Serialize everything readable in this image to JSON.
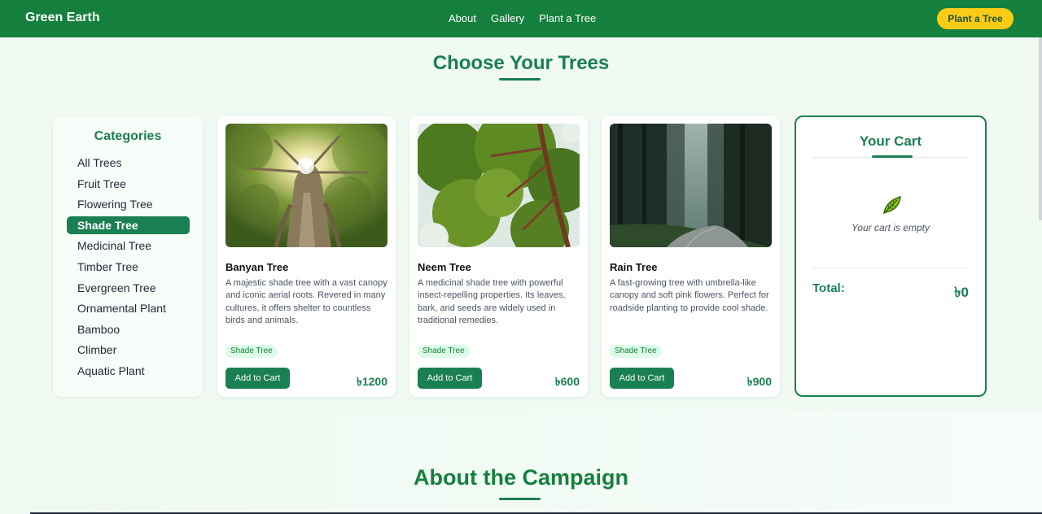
{
  "nav": {
    "brand": "Green Earth",
    "links": [
      "About",
      "Gallery",
      "Plant a Tree"
    ],
    "cta": "Plant a Tree"
  },
  "trees_section": {
    "title": "Choose Your Trees"
  },
  "categories": {
    "title": "Categories",
    "items": [
      "All Trees",
      "Fruit Tree",
      "Flowering Tree",
      "Shade Tree",
      "Medicinal Tree",
      "Timber Tree",
      "Evergreen Tree",
      "Ornamental Plant",
      "Bamboo",
      "Climber",
      "Aquatic Plant"
    ],
    "active": "Shade Tree"
  },
  "cards": [
    {
      "name": "Banyan Tree",
      "description": "A majestic shade tree with a vast canopy and iconic aerial roots. Revered in many cultures, it offers shelter to countless birds and animals.",
      "tag": "Shade Tree",
      "button": "Add to Cart",
      "price": "৳1200"
    },
    {
      "name": "Neem Tree",
      "description": "A medicinal shade tree with powerful insect-repelling properties. Its leaves, bark, and seeds are widely used in traditional remedies.",
      "tag": "Shade Tree",
      "button": "Add to Cart",
      "price": "৳600"
    },
    {
      "name": "Rain Tree",
      "description": "A fast-growing tree with umbrella-like canopy and soft pink flowers. Perfect for roadside planting to provide cool shade.",
      "tag": "Shade Tree",
      "button": "Add to Cart",
      "price": "৳900"
    }
  ],
  "cart": {
    "title": "Your Cart",
    "empty_text": "Your cart is empty",
    "total_label": "Total:",
    "total_value": "৳0",
    "icon": "leaf-icon"
  },
  "about": {
    "title": "About the Campaign"
  },
  "colors": {
    "primary": "#15803d",
    "accent": "#1a7f52",
    "cta": "#facc15"
  }
}
